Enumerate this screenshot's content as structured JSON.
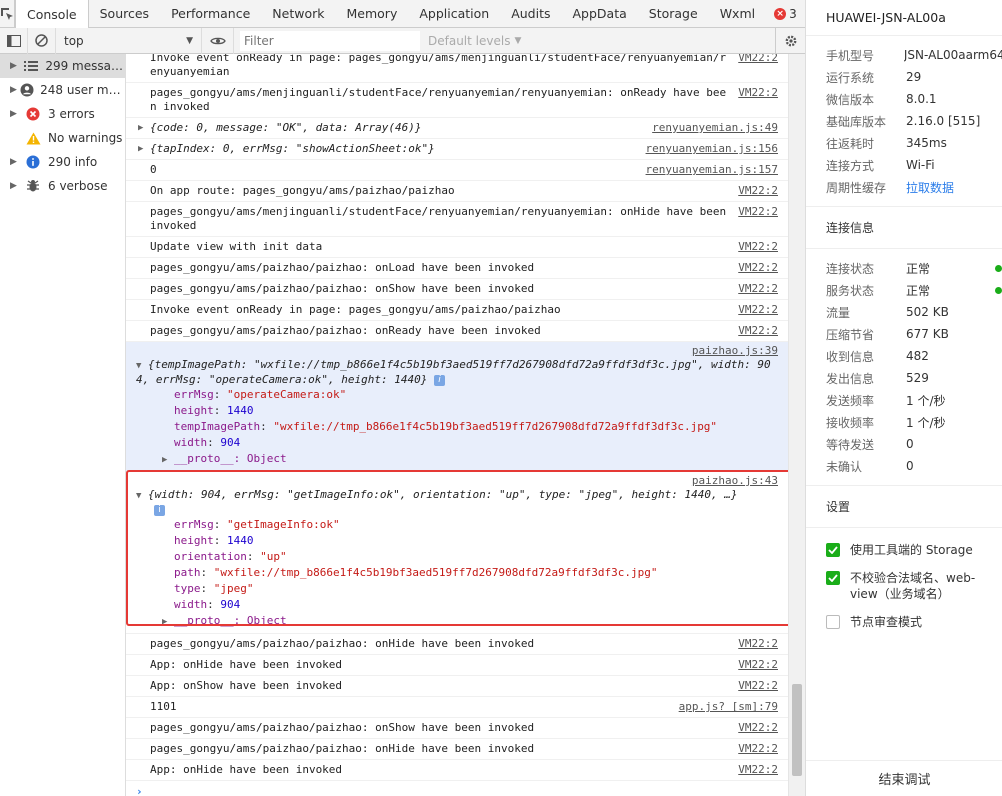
{
  "tabs": [
    {
      "label": "Console",
      "active": true
    },
    {
      "label": "Sources"
    },
    {
      "label": "Performance"
    },
    {
      "label": "Network"
    },
    {
      "label": "Memory"
    },
    {
      "label": "Application"
    },
    {
      "label": "Audits"
    },
    {
      "label": "AppData"
    },
    {
      "label": "Storage"
    },
    {
      "label": "Wxml"
    }
  ],
  "tab_error_count": "3",
  "filterbar": {
    "context": "top",
    "filter_placeholder": "Filter",
    "levels": "Default levels"
  },
  "sidebar": [
    {
      "label": "299 messages",
      "icon": "list-icon"
    },
    {
      "label": "248 user messages",
      "icon": "user-icon"
    },
    {
      "label": "3 errors",
      "icon": "error-icon"
    },
    {
      "label": "No warnings",
      "icon": "warning-icon"
    },
    {
      "label": "290 info",
      "icon": "info-icon"
    },
    {
      "label": "6 verbose",
      "icon": "bug-icon"
    }
  ],
  "log": {
    "r0": {
      "msg": "Invoke event onReady in page: pages_gongyu/ams/menjinguanli/studentFace/renyuanyemian/renyuanyemian",
      "src": "VM22:2"
    },
    "r1": {
      "msg": "pages_gongyu/ams/menjinguanli/studentFace/renyuanyemian/renyuanyemian: onReady have been invoked",
      "src": "VM22:2"
    },
    "r2": {
      "msg": "{code: 0, message: \"OK\", data: Array(46)}",
      "src": "renyuanyemian.js:49"
    },
    "r3": {
      "msg": "{tapIndex: 0, errMsg: \"showActionSheet:ok\"}",
      "src": "renyuanyemian.js:156"
    },
    "r4": {
      "msg": "0",
      "src": "renyuanyemian.js:157"
    },
    "r5": {
      "msg": "On app route: pages_gongyu/ams/paizhao/paizhao",
      "src": "VM22:2"
    },
    "r6": {
      "msg": "pages_gongyu/ams/menjinguanli/studentFace/renyuanyemian/renyuanyemian: onHide have been invoked",
      "src": "VM22:2"
    },
    "r7": {
      "msg": "Update view with init data",
      "src": "VM22:2"
    },
    "r8": {
      "msg": "pages_gongyu/ams/paizhao/paizhao: onLoad have been invoked",
      "src": "VM22:2"
    },
    "r9": {
      "msg": "pages_gongyu/ams/paizhao/paizhao: onShow have been invoked",
      "src": "VM22:2"
    },
    "r10": {
      "msg": "Invoke event onReady in page: pages_gongyu/ams/paizhao/paizhao",
      "src": "VM22:2"
    },
    "r11": {
      "msg": "pages_gongyu/ams/paizhao/paizhao: onReady have been invoked",
      "src": "VM22:2"
    },
    "obj1": {
      "src": "paizhao.js:39",
      "summary": "{tempImagePath: \"wxfile://tmp_b866e1f4c5b19bf3aed519ff7d267908dfd72a9ffdf3df3c.jpg\", width: 904, errMsg: \"operateCamera:ok\", height: 1440}",
      "props": [
        {
          "k": "errMsg",
          "v": "\"operateCamera:ok\"",
          "t": "str"
        },
        {
          "k": "height",
          "v": "1440",
          "t": "num"
        },
        {
          "k": "tempImagePath",
          "v": "\"wxfile://tmp_b866e1f4c5b19bf3aed519ff7d267908dfd72a9ffdf3df3c.jpg\"",
          "t": "str"
        },
        {
          "k": "width",
          "v": "904",
          "t": "num"
        }
      ],
      "proto": "__proto__: Object"
    },
    "obj2": {
      "src": "paizhao.js:43",
      "summary": "{width: 904, errMsg: \"getImageInfo:ok\", orientation: \"up\", type: \"jpeg\", height: 1440, …}",
      "props": [
        {
          "k": "errMsg",
          "v": "\"getImageInfo:ok\"",
          "t": "str"
        },
        {
          "k": "height",
          "v": "1440",
          "t": "num"
        },
        {
          "k": "orientation",
          "v": "\"up\"",
          "t": "str"
        },
        {
          "k": "path",
          "v": "\"wxfile://tmp_b866e1f4c5b19bf3aed519ff7d267908dfd72a9ffdf3df3c.jpg\"",
          "t": "str"
        },
        {
          "k": "type",
          "v": "\"jpeg\"",
          "t": "str"
        },
        {
          "k": "width",
          "v": "904",
          "t": "num"
        }
      ],
      "proto": "__proto__: Object"
    },
    "r12": {
      "msg": "pages_gongyu/ams/paizhao/paizhao: onHide have been invoked",
      "src": "VM22:2"
    },
    "r13": {
      "msg": "App: onHide have been invoked",
      "src": "VM22:2"
    },
    "r14": {
      "msg": "App: onShow have been invoked",
      "src": "VM22:2"
    },
    "r15": {
      "msg": "1101",
      "src": "app.js? [sm]:79"
    },
    "r16": {
      "msg": "pages_gongyu/ams/paizhao/paizhao: onShow have been invoked",
      "src": "VM22:2"
    },
    "r17": {
      "msg": "pages_gongyu/ams/paizhao/paizhao: onHide have been invoked",
      "src": "VM22:2"
    },
    "r18": {
      "msg": "App: onHide have been invoked",
      "src": "VM22:2"
    },
    "prompt": "›"
  },
  "panel": {
    "device": "HUAWEI-JSN-AL00a",
    "info": [
      {
        "k": "手机型号",
        "v": "JSN-AL00aarm64"
      },
      {
        "k": "运行系统",
        "v": "29"
      },
      {
        "k": "微信版本",
        "v": "8.0.1"
      },
      {
        "k": "基础库版本",
        "v": "2.16.0 [515]"
      },
      {
        "k": "往返耗时",
        "v": "345ms"
      },
      {
        "k": "连接方式",
        "v": "Wi-Fi"
      },
      {
        "k": "周期性缓存",
        "v": "拉取数据"
      }
    ],
    "conn_head": "连接信息",
    "conn": [
      {
        "k": "连接状态",
        "v": "正常"
      },
      {
        "k": "服务状态",
        "v": "正常"
      },
      {
        "k": "流量",
        "v": "502 KB"
      },
      {
        "k": "压缩节省",
        "v": "677 KB"
      },
      {
        "k": "收到信息",
        "v": "482"
      },
      {
        "k": "发出信息",
        "v": "529"
      },
      {
        "k": "发送频率",
        "v": "1 个/秒"
      },
      {
        "k": "接收频率",
        "v": "1 个/秒"
      },
      {
        "k": "等待发送",
        "v": "0"
      },
      {
        "k": "未确认",
        "v": "0"
      }
    ],
    "settings_head": "设置",
    "settings": [
      {
        "label": "使用工具端的 Storage",
        "checked": true
      },
      {
        "label": "不校验合法域名、web-view（业务域名）",
        "checked": true
      },
      {
        "label": "节点审查模式",
        "checked": false
      }
    ],
    "end_debug": "结束调试"
  },
  "colors": {
    "accent": "#1aad19",
    "error": "#e53935",
    "link": "#2b7de9"
  }
}
